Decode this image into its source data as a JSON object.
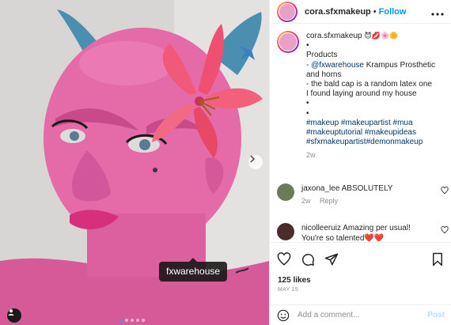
{
  "header": {
    "username": "cora.sfxmakeup",
    "separator": "•",
    "follow_label": "Follow",
    "more_label": "•••"
  },
  "caption": {
    "username": "cora.sfxmakeup",
    "emojis": "😈💋🌸🌼",
    "lines": [
      "•",
      "Products",
      "- @fxwarehouse Krampus Prosthetic",
      "and horns",
      "- the bald cap is a random latex one",
      "I found laying around my house",
      "•",
      "•",
      "#makeup #makeupartist #mua",
      "#makeuptutorial #makeupideas",
      "#sfxmakeupartist#demonmakeup"
    ],
    "time": "2w"
  },
  "comments": [
    {
      "username": "jaxona_lee",
      "text": "ABSOLUTELY",
      "time": "2w",
      "reply_label": "Reply",
      "avatar_color": "#6d7a5a"
    },
    {
      "username": "nicolleeruiz",
      "text": "Amazing per usual!",
      "text2": "You're so talented❤️❤️",
      "avatar_color": "#4a2c2a"
    }
  ],
  "likes": "125 likes",
  "date": "MAY 15",
  "add_comment": {
    "placeholder": "Add a comment...",
    "post_label": "Post"
  },
  "media": {
    "tag_label": "fxwarehouse",
    "carousel_count": 5,
    "active_index": 1
  },
  "colors": {
    "accent": "#0095f6",
    "skin": "#e56aa8",
    "horn": "#4a8fb0"
  }
}
